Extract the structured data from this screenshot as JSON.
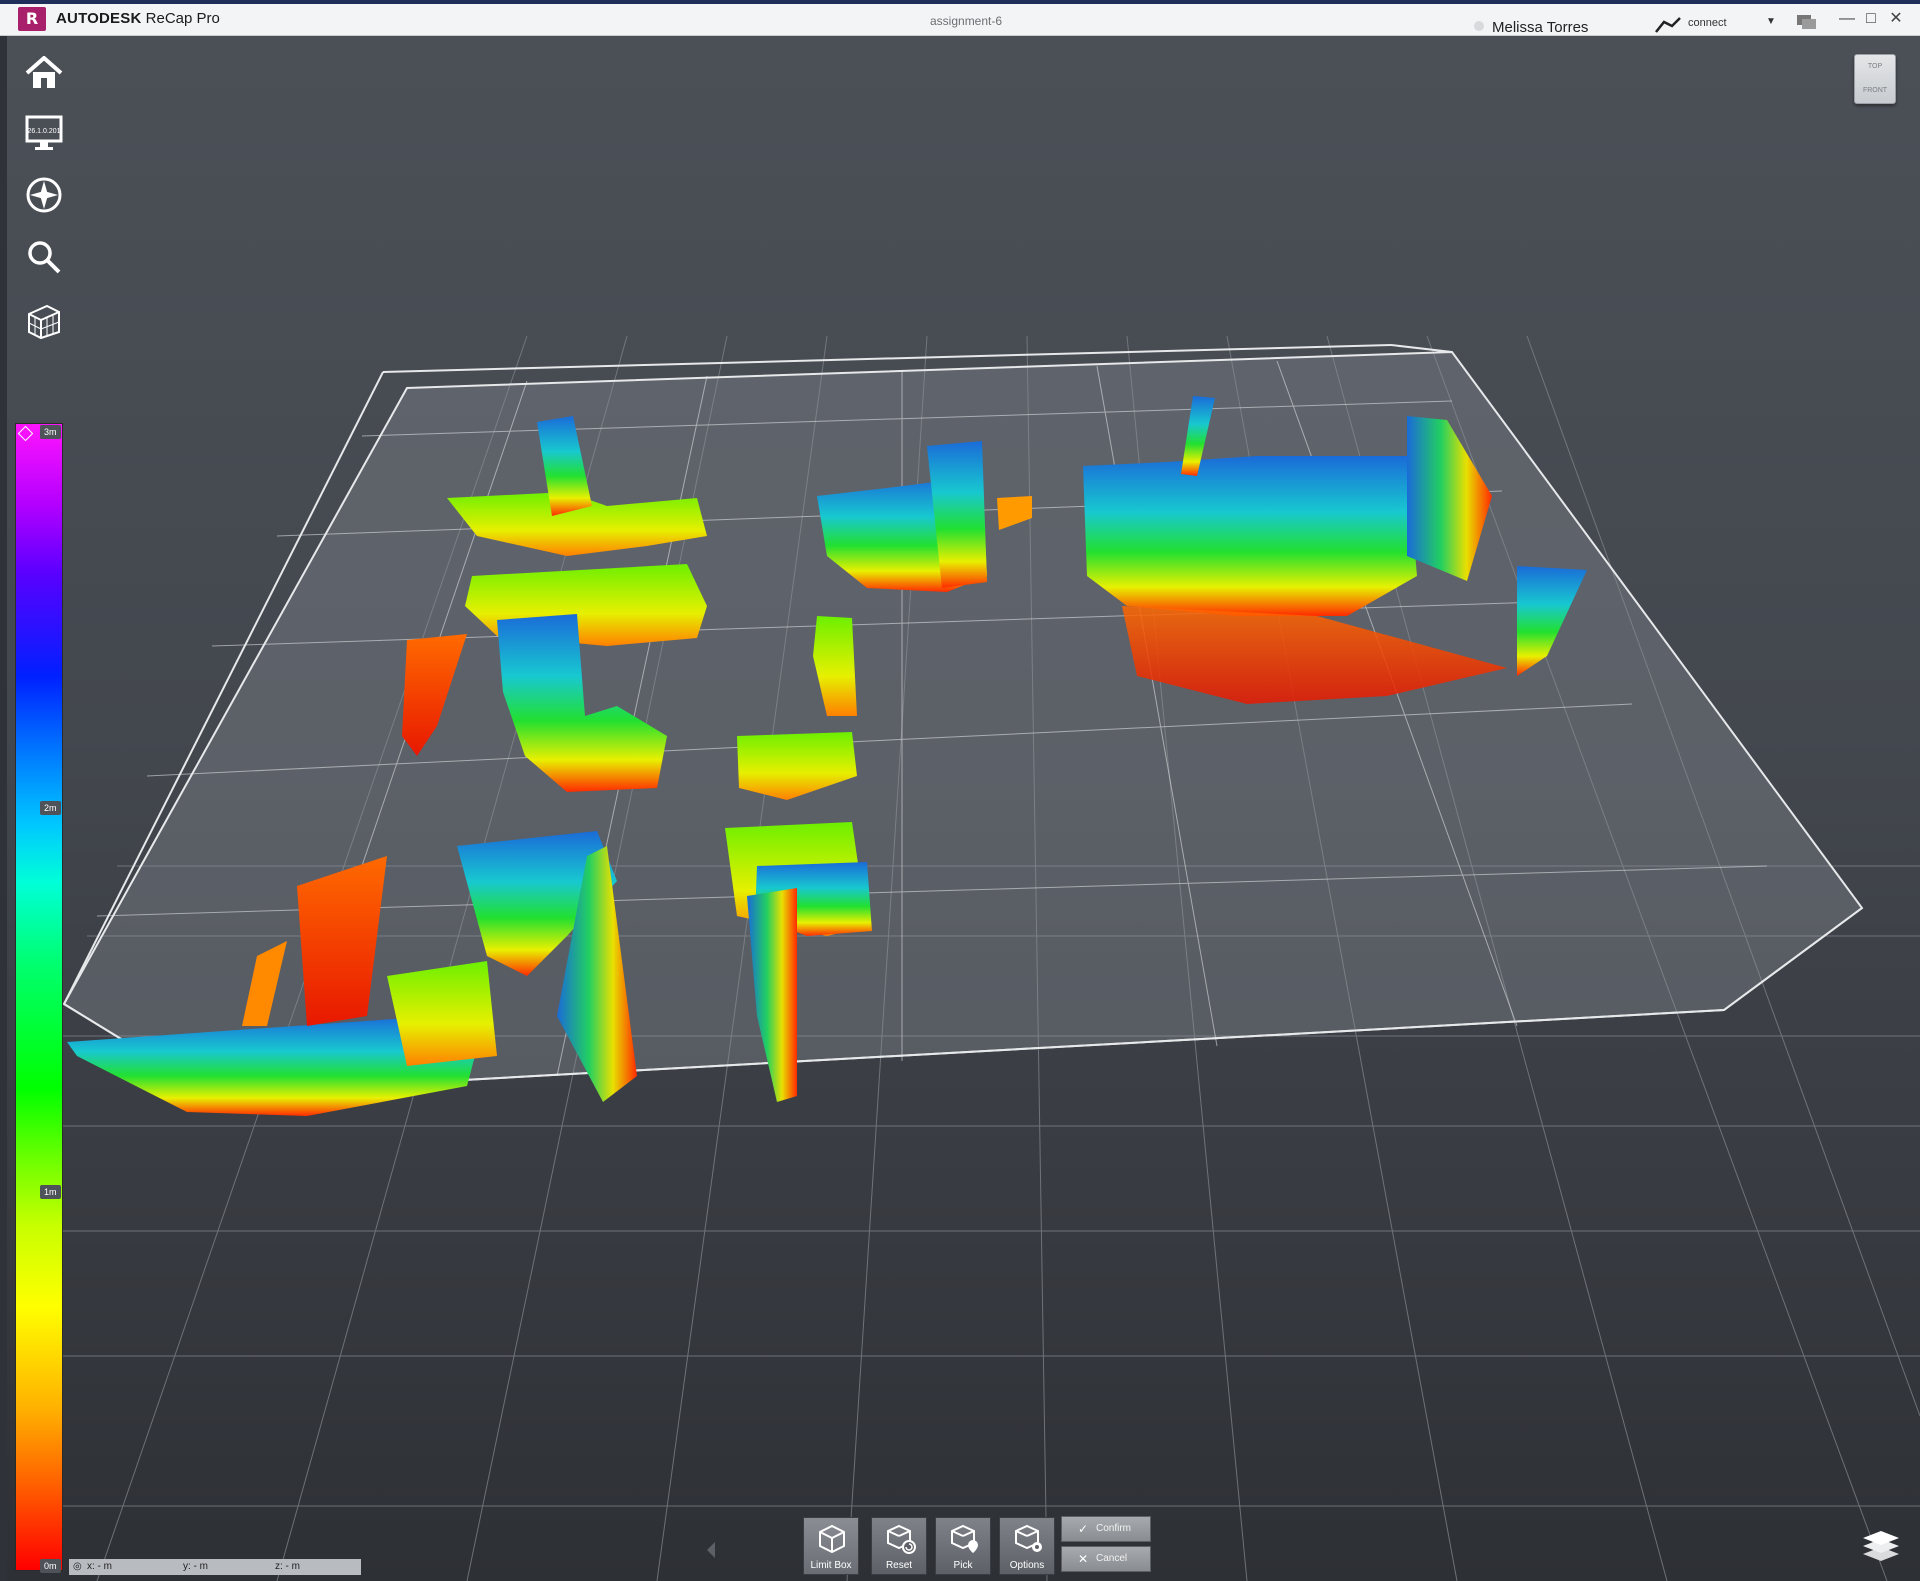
{
  "window": {
    "brand": "AUTODESK",
    "product": "ReCap Pro",
    "logo_letter": "R",
    "project_name": "assignment-6",
    "user_name": "Melissa Torres",
    "connect_label": "connect",
    "controls": [
      "minimize",
      "maximize",
      "close"
    ]
  },
  "side_tools": [
    {
      "name": "home-icon"
    },
    {
      "name": "display-settings-icon",
      "caption": "26.1.0.201"
    },
    {
      "name": "navigation-icon"
    },
    {
      "name": "search-icon"
    },
    {
      "name": "point-cloud-grid-icon"
    }
  ],
  "elevation_legend": {
    "scale": "rainbow",
    "labels": {
      "top": "3m",
      "upper_mid": "2m",
      "lower_mid": "1m",
      "bottom": "0m"
    }
  },
  "coordinates": {
    "x": "x: - m",
    "y": "y: - m",
    "z": "z: - m"
  },
  "viewcube": {
    "top": "TOP",
    "front": "FRONT"
  },
  "limit_box_toolbar": {
    "buttons": [
      {
        "label": "Limit Box",
        "icon": "limit-box-icon"
      },
      {
        "label": "Reset",
        "icon": "reset-icon"
      },
      {
        "label": "Pick",
        "icon": "pick-icon"
      },
      {
        "label": "Options",
        "icon": "options-icon"
      }
    ],
    "confirm_label": "Confirm",
    "cancel_label": "Cancel"
  },
  "colors": {
    "titlebar": "#f3f4f6",
    "viewport_top": "#4b5057",
    "viewport_bottom": "#2d3035",
    "brand": "#a8206b"
  }
}
